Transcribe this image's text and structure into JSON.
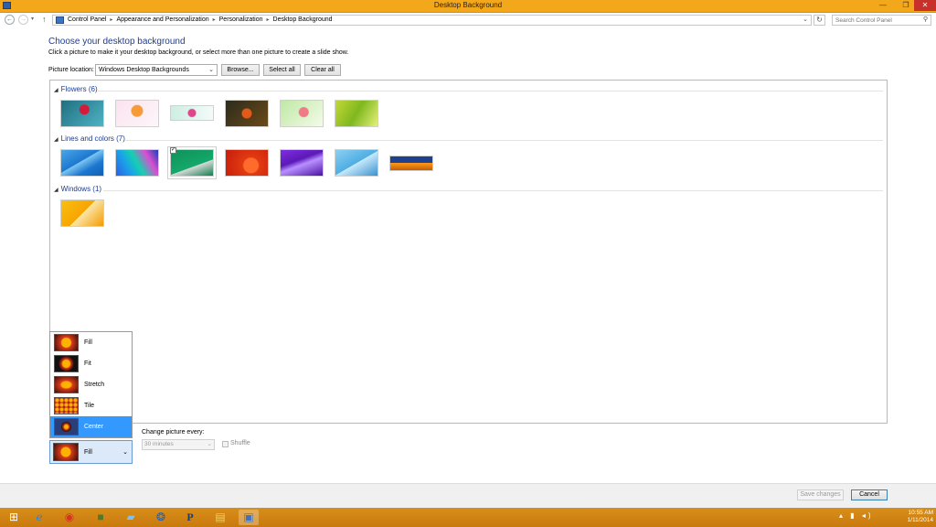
{
  "window": {
    "title": "Desktop Background",
    "min_glyph": "—",
    "max_glyph": "❐",
    "close_glyph": "✕"
  },
  "nav": {
    "back_glyph": "←",
    "forward_glyph": "→",
    "recent_glyph": "▾",
    "up_glyph": "↑",
    "breadcrumbs": [
      "Control Panel",
      "Appearance and Personalization",
      "Personalization",
      "Desktop Background"
    ],
    "breadcrumb_sep": "▸",
    "address_drop_glyph": "⌄",
    "refresh_glyph": "↻",
    "search_placeholder": "Search Control Panel",
    "search_glyph": "⚲"
  },
  "main": {
    "title": "Choose your desktop background",
    "subtitle": "Click a picture to make it your desktop background, or select more than one picture to create a slide show.",
    "location_label": "Picture location:",
    "location_value": "Windows Desktop Backgrounds",
    "dropdown_glyph": "⌄",
    "browse_label": "Browse...",
    "select_all_label": "Select all",
    "clear_all_label": "Clear all"
  },
  "groups": [
    {
      "label": "Flowers (6)",
      "thumbs": [
        {
          "bg": "radial-gradient(circle at 55% 35%, #d61a3a 0 5px, transparent 6px), linear-gradient(135deg,#1f6f80,#4fb3c4)"
        },
        {
          "bg": "radial-gradient(circle at 50% 40%, #f79a38 0 6px, transparent 7px), linear-gradient(135deg,#fbe3ef,#fdf6fa)"
        },
        {
          "bg": "radial-gradient(circle at 50% 50%, #e0468c 0 4px, transparent 5px), linear-gradient(90deg,#cdeee2,#f4fbf8)"
        },
        {
          "bg": "radial-gradient(circle at 50% 50%, #e25a1a 0 5px, transparent 6px), linear-gradient(135deg,#2c2b1d,#6b4a17)"
        },
        {
          "bg": "radial-gradient(circle at 55% 45%, #f07a86 0 5px, transparent 6px), linear-gradient(135deg,#bfe8a4,#f3fbe9)"
        },
        {
          "bg": "linear-gradient(120deg,#c3d736 0%,#7fb81f 50%,#e6f07a 100%)"
        }
      ]
    },
    {
      "label": "Lines and colors (7)",
      "thumbs": [
        {
          "bg": "linear-gradient(150deg,#48a6e8 0%,#1d78cf 45%,#7cc6f2 46%,#1d78cf 70%,#0f5fb4 100%)"
        },
        {
          "bg": "linear-gradient(60deg,#2c5ee6 0%,#1aa3e8 30%,#16d0b0 50%,#d94fd0 75%,#1a3fb5 100%)"
        },
        {
          "bg": "linear-gradient(160deg,#10915a 0%,#14a86a 60%,#d8d8d8 61%,#0e7f4e 100%)"
        },
        {
          "bg": "radial-gradient(circle at 60% 60%, #ff6b2a 0 8px, #e23a12 9px, #c61c0a 100%)"
        },
        {
          "bg": "linear-gradient(160deg,#7f2ee0 0%,#5c19b8 40%,#b890ff 55%,#4a11a0 100%)"
        },
        {
          "bg": "linear-gradient(150deg,#8ccff2 0%,#4faee3 50%,#c7e9fa 51%,#3a92cf 100%)"
        },
        {
          "bg": "linear-gradient(180deg,#1f3f8f 0%,#1f3f8f 45%,#ff9a1c 46%,#c35e00 100%)"
        }
      ]
    },
    {
      "label": "Windows (1)",
      "thumbs": [
        {
          "bg": "linear-gradient(135deg,#f9c013 0%,#f7a500 50%,#fbe6a8 51%,#f49b00 100%)"
        }
      ]
    }
  ],
  "picture_position": {
    "options": [
      "Fill",
      "Fit",
      "Stretch",
      "Tile",
      "Center"
    ],
    "highlighted": "Center",
    "selected": "Fill",
    "dropdown_glyph": "⌄"
  },
  "slideshow": {
    "change_label": "Change picture every:",
    "interval_value": "30 minutes",
    "shuffle_label": "Shuffle"
  },
  "footer": {
    "save_label": "Save changes",
    "cancel_label": "Cancel"
  },
  "taskbar": {
    "items": [
      {
        "icon": "start-icon",
        "glyph": "⊞",
        "color": "#ffffff"
      },
      {
        "icon": "internet-explorer-icon",
        "glyph": "ℯ",
        "color": "#1e88e5"
      },
      {
        "icon": "chrome-icon",
        "glyph": "◉",
        "color": "#d93025"
      },
      {
        "icon": "minecraft-icon",
        "glyph": "■",
        "color": "#4e7a2e"
      },
      {
        "icon": "book-icon",
        "glyph": "▰",
        "color": "#7ec0ee"
      },
      {
        "icon": "media-center-icon",
        "glyph": "❂",
        "color": "#1b5fbf"
      },
      {
        "icon": "pandora-icon",
        "glyph": "P",
        "color": "#1f3a6d"
      },
      {
        "icon": "file-explorer-icon",
        "glyph": "▤",
        "color": "#f4cf5e"
      },
      {
        "icon": "control-panel-icon",
        "glyph": "▣",
        "color": "#3b74c4"
      }
    ],
    "tray_glyphs": "▴ ▮ ◂)",
    "time": "10:55 AM",
    "date": "1/11/2014"
  },
  "colors": {
    "accent": "#f3a81c",
    "link_blue": "#1e3d8f",
    "highlight": "#3399ff"
  }
}
